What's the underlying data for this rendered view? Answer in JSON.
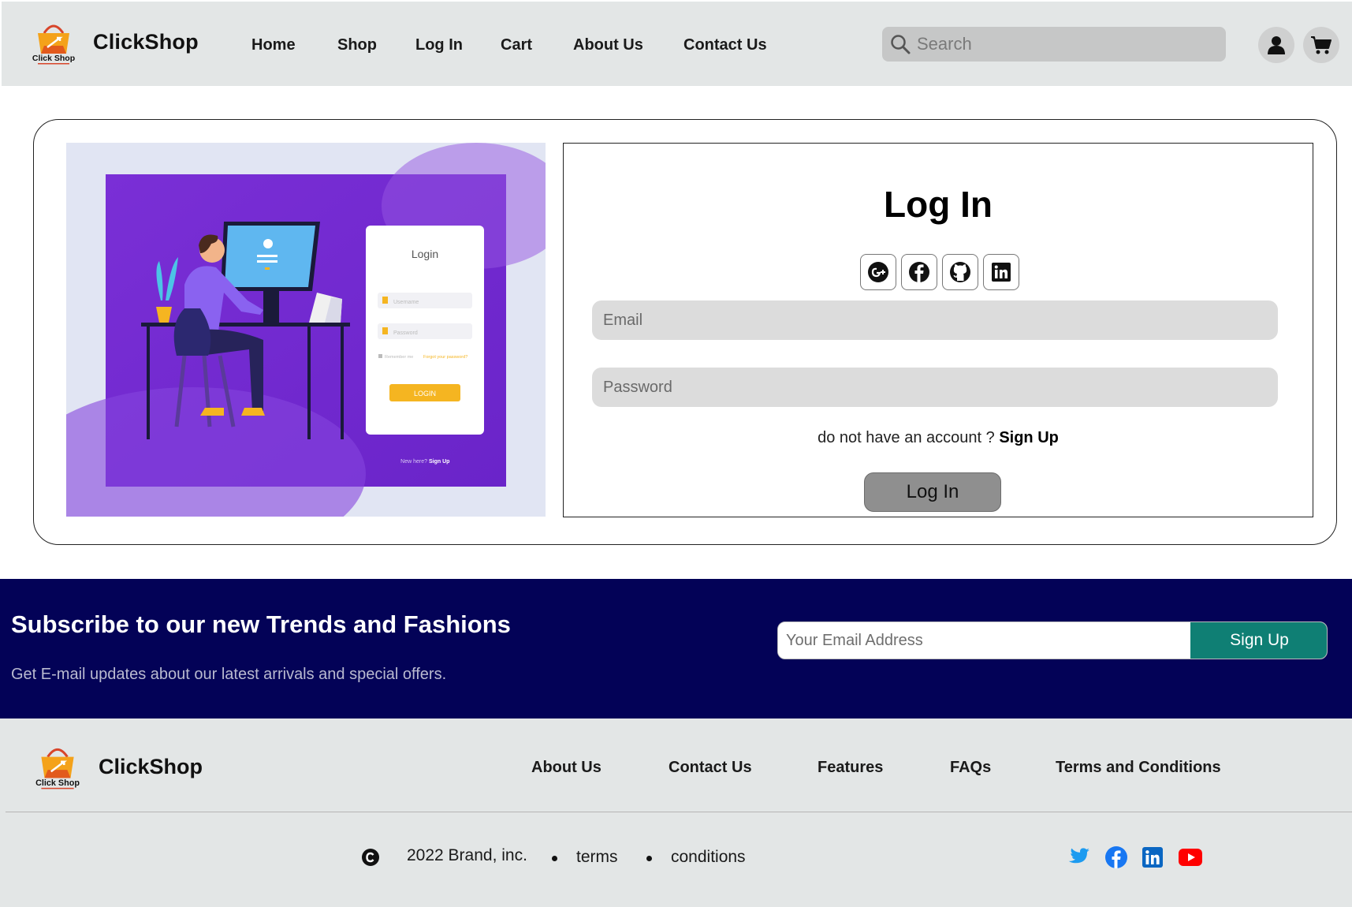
{
  "header": {
    "logo_text": "Click Shop",
    "brand": "ClickShop",
    "nav": [
      "Home",
      "Shop",
      "Log In",
      "Cart",
      "About Us",
      "Contact Us"
    ],
    "search_placeholder": "Search",
    "icons": [
      "search-icon",
      "user-icon",
      "cart-icon"
    ]
  },
  "illustration": {
    "card_title": "Login",
    "username_placeholder": "Username",
    "password_placeholder": "Password",
    "remember": "Remember me",
    "forgot": "Forgot your password?",
    "button": "LOGIN",
    "footer_prefix": "New here?",
    "footer_link": "Sign Up"
  },
  "login": {
    "title": "Log In",
    "social": [
      "google-plus-icon",
      "facebook-icon",
      "github-icon",
      "linkedin-icon"
    ],
    "email_placeholder": "Email",
    "password_placeholder": "Password",
    "no_account": "do not have an account ?",
    "signup_link": "Sign Up",
    "submit": "Log In"
  },
  "subscribe": {
    "title": "Subscribe to our new Trends and Fashions",
    "subtitle": "Get E-mail updates about our latest arrivals and special offers.",
    "email_placeholder": "Your Email Address",
    "button": "Sign Up",
    "colors": {
      "background": "#030257",
      "button": "#0f7f74"
    }
  },
  "footer": {
    "logo_text": "Click Shop",
    "brand": "ClickShop",
    "links": [
      "About Us",
      "Contact Us",
      "Features",
      "FAQs",
      "Terms and Conditions"
    ],
    "copyright": "2022 Brand, inc.",
    "terms": "terms",
    "conditions": "conditions",
    "social": [
      "twitter-icon",
      "facebook-icon",
      "linkedin-icon",
      "youtube-icon"
    ],
    "colors": {
      "twitter": "#1d9bf0",
      "facebook": "#1877f2",
      "linkedin": "#0a66c2",
      "youtube": "#ff0000"
    }
  }
}
